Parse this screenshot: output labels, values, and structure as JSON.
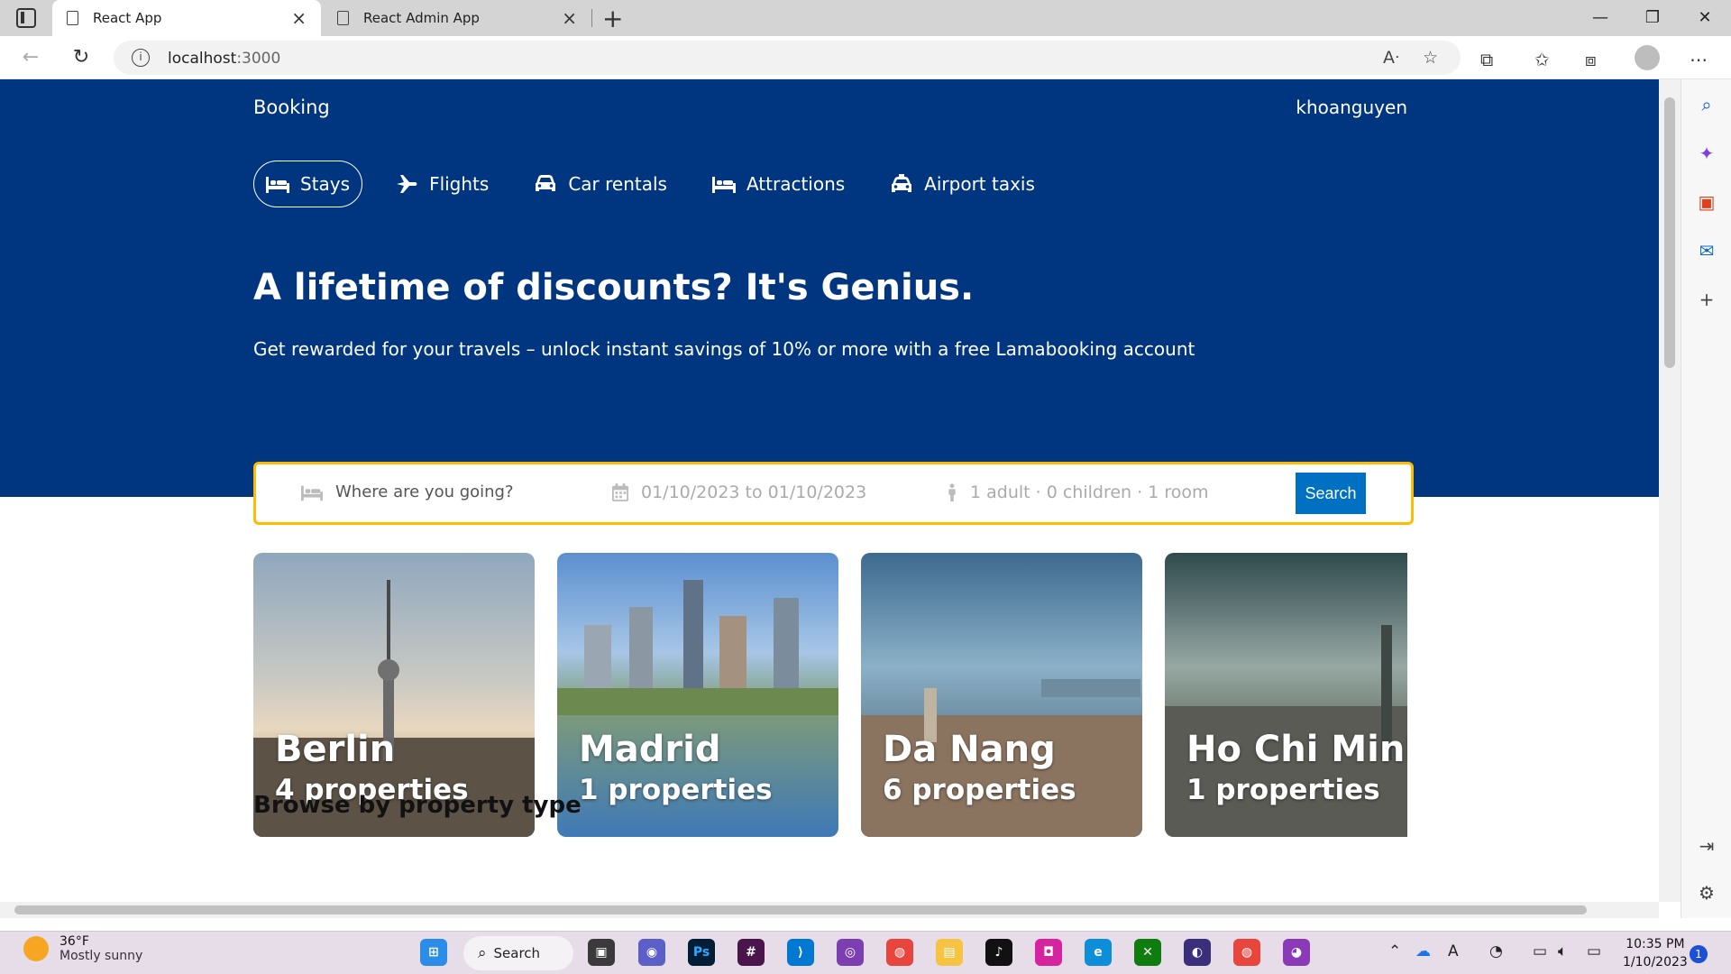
{
  "browser": {
    "tabs": [
      {
        "title": "React App",
        "active": true
      },
      {
        "title": "React Admin App",
        "active": false
      }
    ],
    "address": {
      "host": "localhost",
      "port": ":3000"
    }
  },
  "app": {
    "logo": "Booking",
    "username": "khoanguyen",
    "nav": [
      {
        "label": "Stays",
        "icon": "bed-icon",
        "active": true
      },
      {
        "label": "Flights",
        "icon": "plane-icon",
        "active": false
      },
      {
        "label": "Car rentals",
        "icon": "car-icon",
        "active": false
      },
      {
        "label": "Attractions",
        "icon": "bed-icon",
        "active": false
      },
      {
        "label": "Airport taxis",
        "icon": "taxi-icon",
        "active": false
      }
    ],
    "hero": {
      "title": "A lifetime of discounts? It's Genius.",
      "description": "Get rewarded for your travels – unlock instant savings of 10% or more with a free Lamabooking account"
    },
    "search": {
      "destination_placeholder": "Where are you going?",
      "dates": "01/10/2023 to 01/10/2023",
      "guests": "1 adult · 0 children · 1 room",
      "button_label": "Search"
    },
    "featured": [
      {
        "city": "Berlin",
        "properties": "4 properties"
      },
      {
        "city": "Madrid",
        "properties": "1 properties"
      },
      {
        "city": "Da Nang",
        "properties": "6 properties"
      },
      {
        "city": "Ho Chi Minh",
        "properties": "1 properties"
      }
    ],
    "section_title": "Browse by property type"
  },
  "taskbar": {
    "weather": {
      "temp": "36°F",
      "condition": "Mostly sunny"
    },
    "search_label": "Search",
    "time": "10:35 PM",
    "date": "1/10/2023",
    "notifications": "1"
  },
  "colors": {
    "brand": "#003580",
    "accent": "#febb02",
    "button": "#0071c2"
  }
}
